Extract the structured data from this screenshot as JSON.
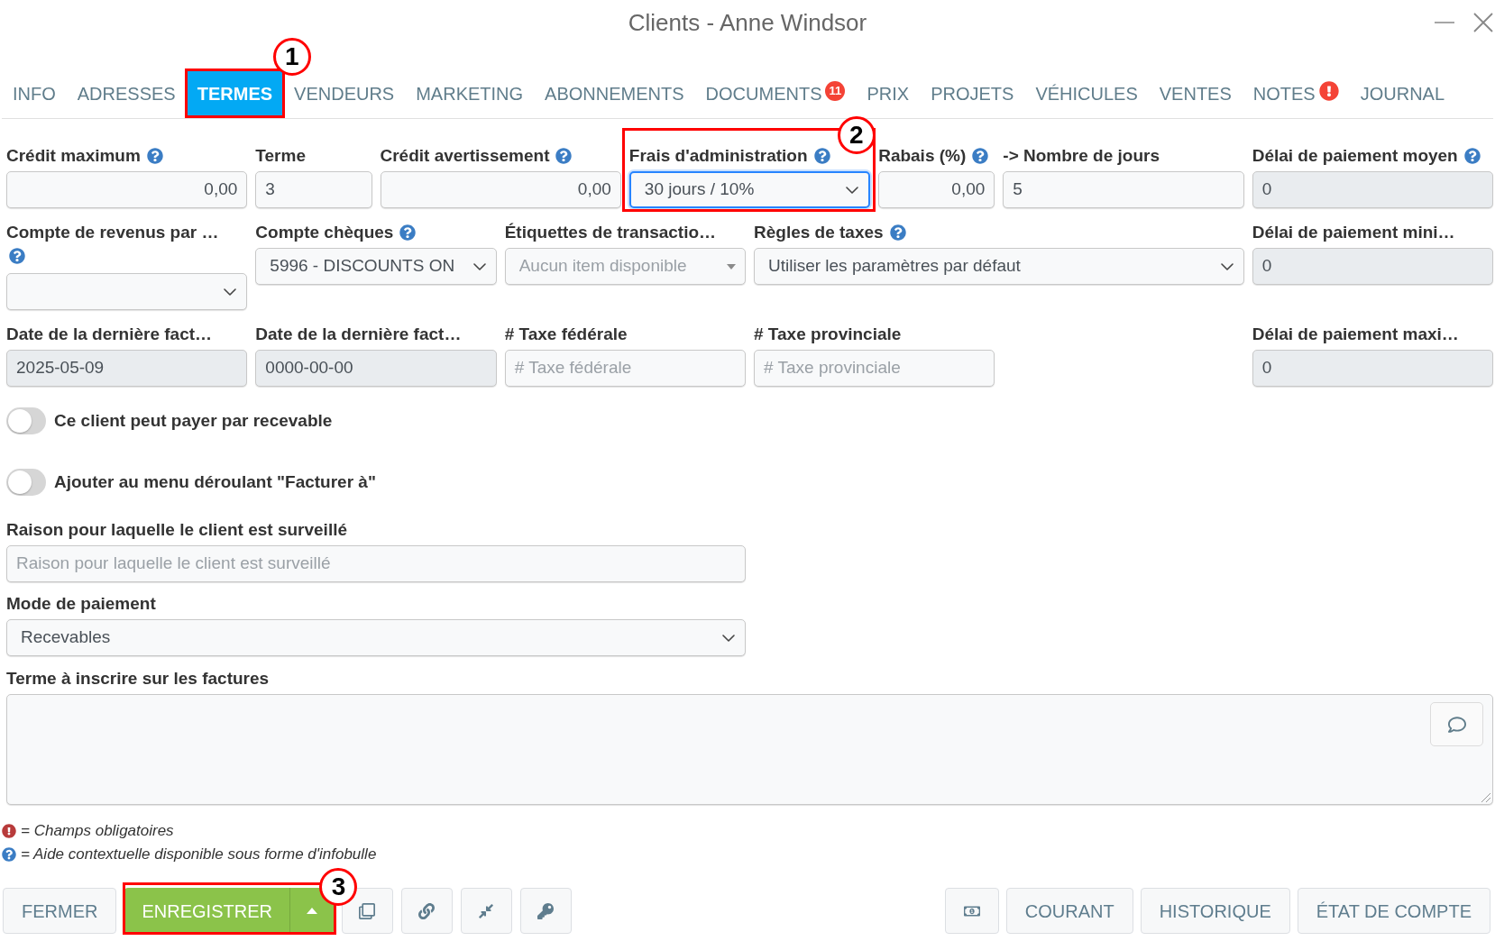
{
  "window": {
    "title": "Clients - Anne Windsor"
  },
  "tabs": [
    {
      "label": "INFO",
      "selected": false
    },
    {
      "label": "ADRESSES",
      "selected": false
    },
    {
      "label": "TERMES",
      "selected": true,
      "callout": "1"
    },
    {
      "label": "VENDEURS",
      "selected": false
    },
    {
      "label": "MARKETING",
      "selected": false
    },
    {
      "label": "ABONNEMENTS",
      "selected": false
    },
    {
      "label": "DOCUMENTS",
      "selected": false,
      "badge": {
        "kind": "count",
        "text": "11"
      }
    },
    {
      "label": "PRIX",
      "selected": false
    },
    {
      "label": "PROJETS",
      "selected": false
    },
    {
      "label": "VÉHICULES",
      "selected": false
    },
    {
      "label": "VENTES",
      "selected": false
    },
    {
      "label": "NOTES",
      "selected": false,
      "badge": {
        "kind": "alert"
      }
    },
    {
      "label": "JOURNAL",
      "selected": false
    }
  ],
  "form_rows": [
    {
      "fields": [
        {
          "label": "Crédit maximum",
          "help": true,
          "kind": "number",
          "value": "0,00",
          "disabled": false,
          "focused": false
        },
        {
          "label": "Terme",
          "help": false,
          "kind": "text",
          "value": "3",
          "disabled": false,
          "focused": false
        },
        {
          "label": "Crédit avertissement",
          "help": true,
          "kind": "number",
          "value": "0,00",
          "disabled": false,
          "focused": false
        },
        {
          "label": "Frais d'administration",
          "help": true,
          "kind": "select",
          "value": "30 jours / 10%",
          "disabled": false,
          "focused": true,
          "callout": "2"
        },
        {
          "label": "Rabais (%)",
          "help": true,
          "kind": "number",
          "value": "0,00",
          "disabled": false,
          "focused": false
        },
        {
          "label": "-> Nombre de jours",
          "help": false,
          "kind": "text",
          "value": "5",
          "disabled": false,
          "focused": false
        },
        {
          "label": "Délai de paiement moyen",
          "help": true,
          "kind": "text",
          "value": "0",
          "disabled": true,
          "focused": false
        }
      ]
    },
    {
      "fields": [
        {
          "label": "Compte de revenus par …",
          "help": true,
          "kind": "select",
          "disabled": false,
          "focused": false
        },
        {
          "label": "Compte chèques",
          "help": true,
          "kind": "select",
          "value": "5996 - DISCOUNTS ON",
          "disabled": false,
          "focused": false
        },
        {
          "label": "Étiquettes de transactio…",
          "help": false,
          "kind": "dropdown",
          "placeholder": "Aucun item disponible",
          "disabled": false,
          "focused": false
        },
        {
          "label": "Règles de taxes",
          "help": true,
          "kind": "select",
          "value": "Utiliser les paramètres par défaut",
          "disabled": false,
          "focused": false
        },
        {
          "label": "Délai de paiement mini…",
          "help": false,
          "kind": "text",
          "value": "0",
          "disabled": true,
          "focused": false
        }
      ]
    },
    {
      "fields": [
        {
          "label": "Date de la dernière fact…",
          "help": false,
          "kind": "text",
          "value": "2025-05-09",
          "disabled": true,
          "focused": false
        },
        {
          "label": "Date de la dernière fact…",
          "help": false,
          "kind": "text",
          "value": "0000-00-00",
          "disabled": true,
          "focused": false
        },
        {
          "label": "# Taxe fédérale",
          "help": false,
          "kind": "text",
          "placeholder": "# Taxe fédérale",
          "disabled": false,
          "focused": false
        },
        {
          "label": "# Taxe provinciale",
          "help": false,
          "kind": "text",
          "placeholder": "# Taxe provinciale",
          "disabled": false,
          "focused": false
        },
        {
          "label": "Délai de paiement maxi…",
          "help": false,
          "kind": "text",
          "value": "0",
          "disabled": true,
          "focused": false
        }
      ]
    }
  ],
  "toggles": [
    {
      "label": "Ce client peut payer par recevable",
      "on": false
    },
    {
      "label": "Ajouter au menu déroulant \"Facturer à\"",
      "on": false
    }
  ],
  "watch_reason": {
    "label": "Raison pour laquelle le client est surveillé",
    "placeholder": "Raison pour laquelle le client est surveillé"
  },
  "payment_mode": {
    "label": "Mode de paiement",
    "value": "Recevables"
  },
  "invoice_terms": {
    "label": "Terme à inscrire sur les factures"
  },
  "legend": [
    {
      "kind": "required",
      "text": "= Champs obligatoires"
    },
    {
      "kind": "help",
      "text": "= Aide contextuelle disponible sous forme d'infobulle"
    }
  ],
  "footer_left": [
    {
      "kind": "plain",
      "label": "FERMER"
    },
    {
      "kind": "split",
      "label": "ENREGISTRER",
      "callout": "3"
    },
    {
      "kind": "icon"
    },
    {
      "kind": "icon"
    },
    {
      "kind": "icon"
    },
    {
      "kind": "icon"
    }
  ],
  "footer_right": [
    {
      "kind": "icon"
    },
    {
      "kind": "plain",
      "label": "COURANT"
    },
    {
      "kind": "plain",
      "label": "HISTORIQUE"
    },
    {
      "kind": "plain",
      "label": "ÉTAT DE COMPTE"
    }
  ]
}
